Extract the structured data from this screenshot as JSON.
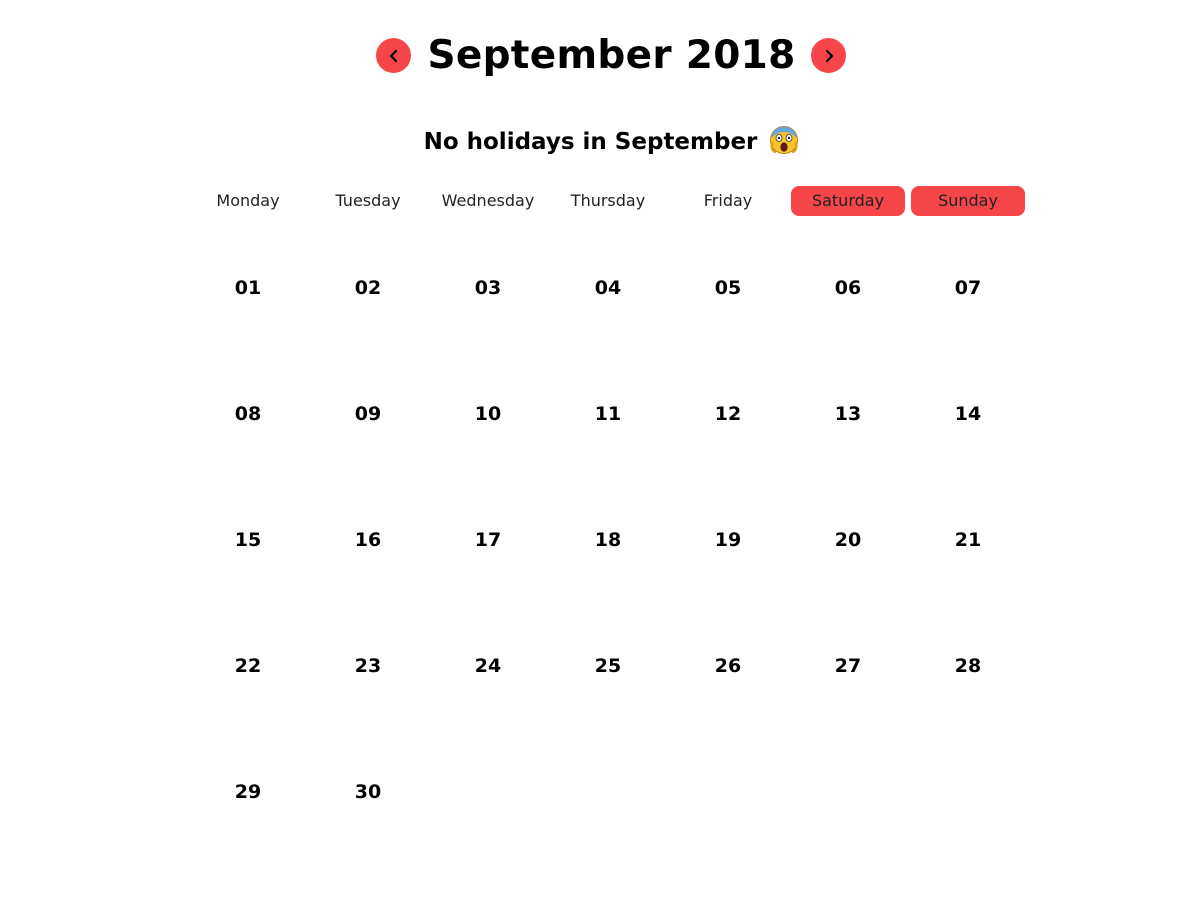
{
  "header": {
    "title": "September 2018",
    "prev_icon": "chevron-left-icon",
    "next_icon": "chevron-right-icon"
  },
  "holiday_note": "No holidays in September",
  "holiday_emoji": "screaming-face-emoji",
  "colors": {
    "accent": "#f6464a"
  },
  "weekdays": [
    "Monday",
    "Tuesday",
    "Wednesday",
    "Thursday",
    "Friday",
    "Saturday",
    "Sunday"
  ],
  "weekend_highlight": [
    "Saturday",
    "Sunday"
  ],
  "weeks": [
    [
      "01",
      "02",
      "03",
      "04",
      "05",
      "06",
      "07"
    ],
    [
      "08",
      "09",
      "10",
      "11",
      "12",
      "13",
      "14"
    ],
    [
      "15",
      "16",
      "17",
      "18",
      "19",
      "20",
      "21"
    ],
    [
      "22",
      "23",
      "24",
      "25",
      "26",
      "27",
      "28"
    ],
    [
      "29",
      "30",
      "",
      "",
      "",
      "",
      ""
    ]
  ]
}
